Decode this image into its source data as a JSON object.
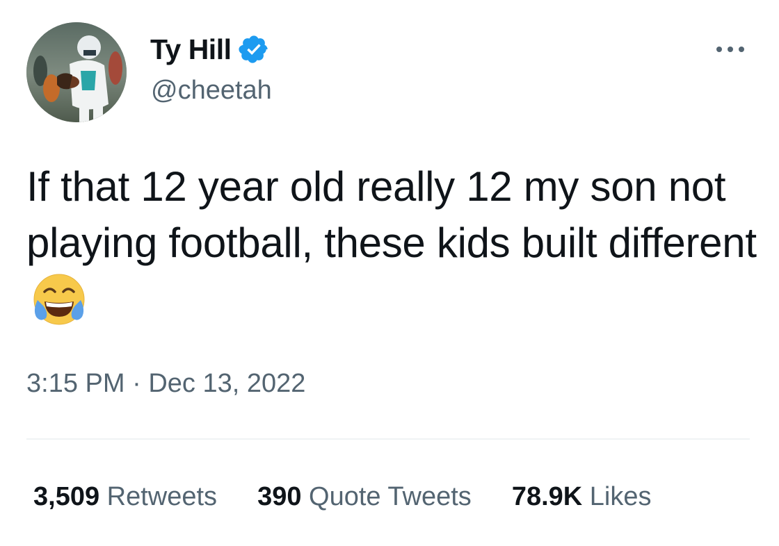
{
  "author": {
    "display_name": "Ty Hill",
    "handle": "@cheetah",
    "verified": true,
    "avatar_icon": "football-player-photo"
  },
  "menu": {
    "more_icon": "more-horizontal-icon"
  },
  "tweet": {
    "text": "If that 12 year old really 12 my son not playing football, these kids built different",
    "emoji": "face-with-tears-of-joy"
  },
  "meta": {
    "time": "3:15 PM",
    "separator": "·",
    "date": "Dec 13, 2022"
  },
  "stats": {
    "retweets": {
      "count": "3,509",
      "label": "Retweets"
    },
    "quotes": {
      "count": "390",
      "label": "Quote Tweets"
    },
    "likes": {
      "count": "78.9K",
      "label": "Likes"
    }
  },
  "colors": {
    "primary_text": "#0f1419",
    "secondary_text": "#536471",
    "verified_blue": "#1d9bf0",
    "divider": "#eff3f4"
  }
}
